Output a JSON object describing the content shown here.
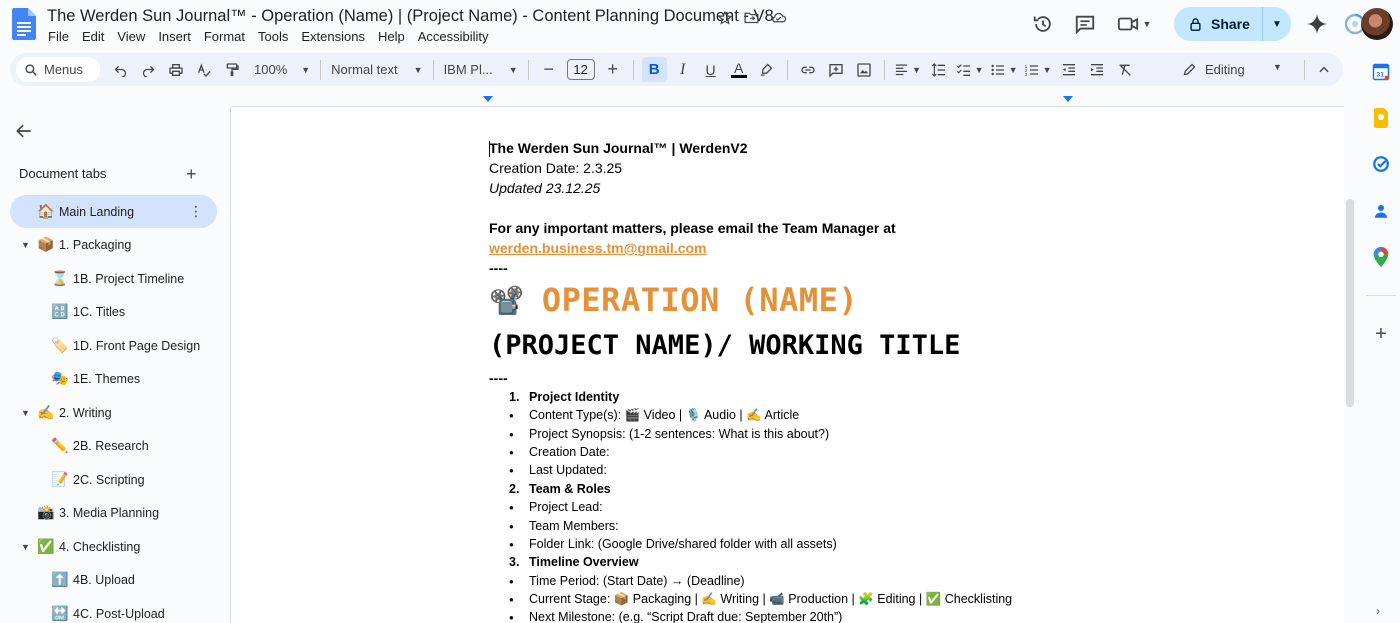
{
  "app": {
    "title": "The Werden Sun Journal™ - Operation (Name) | (Project Name) - Content Planning Document - V8",
    "menu": [
      "File",
      "Edit",
      "View",
      "Insert",
      "Format",
      "Tools",
      "Extensions",
      "Help",
      "Accessibility"
    ],
    "share_label": "Share"
  },
  "toolbar": {
    "menus_label": "Menus",
    "zoom": "100%",
    "style": "Normal text",
    "font": "IBM Pl...",
    "font_size": "12",
    "editing_mode": "Editing"
  },
  "sidebar": {
    "heading": "Document tabs",
    "tabs": [
      {
        "emoji": "🏠",
        "label": "Main Landing"
      },
      {
        "emoji": "📦",
        "label": "1. Packaging"
      },
      {
        "emoji": "⌛",
        "label": "1B. Project Timeline"
      },
      {
        "emoji": "🔠",
        "label": "1C. Titles"
      },
      {
        "emoji": "🏷️",
        "label": "1D. Front Page Design"
      },
      {
        "emoji": "🎭",
        "label": "1E. Themes"
      },
      {
        "emoji": "✍️",
        "label": "2. Writing"
      },
      {
        "emoji": "✏️",
        "label": "2B. Research"
      },
      {
        "emoji": "📝",
        "label": "2C. Scripting"
      },
      {
        "emoji": "📸",
        "label": "3. Media Planning"
      },
      {
        "emoji": "✅",
        "label": "4. Checklisting"
      },
      {
        "emoji": "⬆️",
        "label": "4B. Upload"
      },
      {
        "emoji": "🔛",
        "label": "4C. Post-Upload"
      }
    ]
  },
  "document": {
    "header_line": "The Werden Sun Journal™ | WerdenV2",
    "creation_date": "Creation Date: 2.3.25",
    "updated": "Updated 23.12.25",
    "important_notice": "For any important matters, please email the Team Manager at",
    "email": "werden.business.tm@gmail.com",
    "separator": "----",
    "operation_emoji": "📽️",
    "operation_title": "OPERATION (NAME)",
    "project_title": "(PROJECT NAME)/ WORKING TITLE",
    "list": [
      {
        "marker": "1.",
        "text": "Project Identity",
        "bold": true
      },
      {
        "marker": "●",
        "text": "Content Type(s): 🎬 Video | 🎙️ Audio | ✍️ Article",
        "bold": false
      },
      {
        "marker": "●",
        "text": "Project Synopsis: (1-2 sentences: What is this about?)",
        "bold": false
      },
      {
        "marker": "●",
        "text": "Creation Date:",
        "bold": false
      },
      {
        "marker": "●",
        "text": "Last Updated:",
        "bold": false
      },
      {
        "marker": "2.",
        "text": "Team & Roles",
        "bold": true
      },
      {
        "marker": "●",
        "text": "Project Lead:",
        "bold": false
      },
      {
        "marker": "●",
        "text": "Team Members:",
        "bold": false
      },
      {
        "marker": "●",
        "text": "Folder Link: (Google Drive/shared folder with all assets)",
        "bold": false
      },
      {
        "marker": "3.",
        "text": "Timeline Overview",
        "bold": true
      },
      {
        "marker": "●",
        "text": "Time Period: (Start Date) → (Deadline)",
        "bold": false
      },
      {
        "marker": "●",
        "text": "Current Stage: 📦 Packaging | ✍️ Writing | 📹 Production | 🧩 Editing | ✅ Checklisting",
        "bold": false
      },
      {
        "marker": "●",
        "text": "Next Milestone: (e.g. “Script Draft due: September 20th”)",
        "bold": false
      }
    ]
  }
}
